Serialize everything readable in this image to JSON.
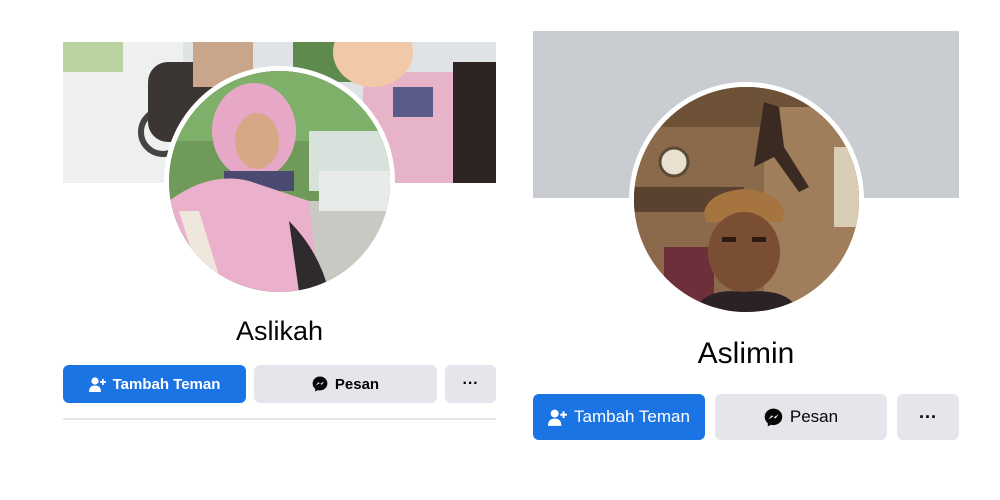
{
  "profiles": [
    {
      "name": "Aslikah",
      "add_friend_label": "Tambah Teman",
      "message_label": "Pesan",
      "more_label": "···"
    },
    {
      "name": "Aslimin",
      "add_friend_label": "Tambah Teman",
      "message_label": "Pesan",
      "more_label": "···"
    }
  ],
  "colors": {
    "primary_button": "#1b74e4",
    "secondary_button": "#e4e6eb",
    "cover_placeholder": "#c9ccd1",
    "text": "#050505"
  },
  "icons": [
    "add-friend-icon",
    "messenger-icon",
    "more-icon"
  ]
}
